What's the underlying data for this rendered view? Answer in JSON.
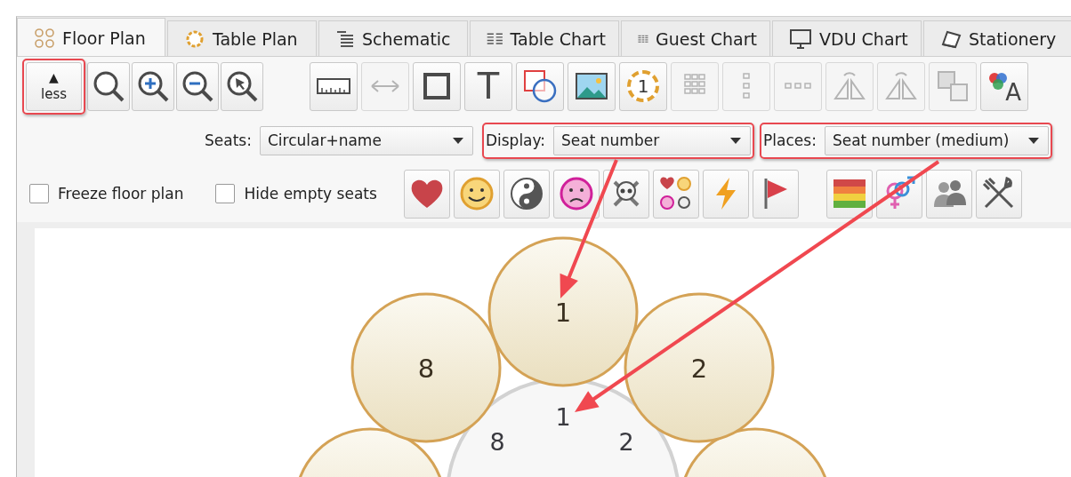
{
  "tabs": [
    {
      "label": "Floor Plan",
      "selected": true
    },
    {
      "label": "Table Plan",
      "selected": false
    },
    {
      "label": "Schematic",
      "selected": false
    },
    {
      "label": "Table Chart",
      "selected": false
    },
    {
      "label": "Guest Chart",
      "selected": false
    },
    {
      "label": "VDU Chart",
      "selected": false
    },
    {
      "label": "Stationery",
      "selected": false
    }
  ],
  "toolbar": {
    "less_button": {
      "icon": "▲",
      "label": "less"
    },
    "groups": [
      {
        "buttons": [
          {
            "kind": "zoom",
            "disabled": false
          },
          {
            "kind": "zoomin",
            "disabled": false
          },
          {
            "kind": "zoomout",
            "disabled": false
          },
          {
            "kind": "zoomselect",
            "disabled": false
          }
        ]
      },
      {
        "buttons": [
          {
            "kind": "ruler",
            "disabled": false
          },
          {
            "kind": "arrows",
            "disabled": true
          },
          {
            "kind": "rectangle",
            "disabled": false
          },
          {
            "kind": "text",
            "glyph": "T",
            "disabled": false
          },
          {
            "kind": "shapes",
            "disabled": false
          },
          {
            "kind": "image",
            "disabled": false
          },
          {
            "kind": "numbering",
            "glyph": "1",
            "disabled": false
          },
          {
            "kind": "grid",
            "disabled": true
          },
          {
            "kind": "column",
            "disabled": true
          },
          {
            "kind": "row",
            "disabled": true
          },
          {
            "kind": "fliph",
            "disabled": true
          },
          {
            "kind": "flipv",
            "disabled": true
          },
          {
            "kind": "arrange",
            "disabled": true
          },
          {
            "kind": "style",
            "glyph": "A",
            "disabled": false
          }
        ]
      }
    ]
  },
  "view_options": [
    {
      "label": "Seats:",
      "value": "Circular+name"
    },
    {
      "label": "Display:",
      "value": "Seat number"
    },
    {
      "label": "Places:",
      "value": "Seat number (medium)"
    }
  ],
  "checkboxes": [
    {
      "label": "Freeze floor plan",
      "checked": false
    },
    {
      "label": "Hide empty seats",
      "checked": false
    }
  ],
  "tag_groups": [
    {
      "buttons": [
        {
          "kind": "heart"
        },
        {
          "kind": "smile"
        },
        {
          "kind": "yinyang"
        },
        {
          "kind": "sad"
        },
        {
          "kind": "skull"
        },
        {
          "kind": "mixed"
        },
        {
          "kind": "bolt"
        },
        {
          "kind": "flag"
        }
      ]
    },
    {
      "buttons": [
        {
          "kind": "stripes"
        },
        {
          "kind": "gender"
        },
        {
          "kind": "people"
        },
        {
          "kind": "cutlery"
        }
      ]
    }
  ],
  "floor_plan": {
    "seats": [
      {
        "number": "1"
      },
      {
        "number": "8"
      },
      {
        "number": "2"
      }
    ],
    "table_places": [
      "1",
      "8",
      "2"
    ]
  }
}
